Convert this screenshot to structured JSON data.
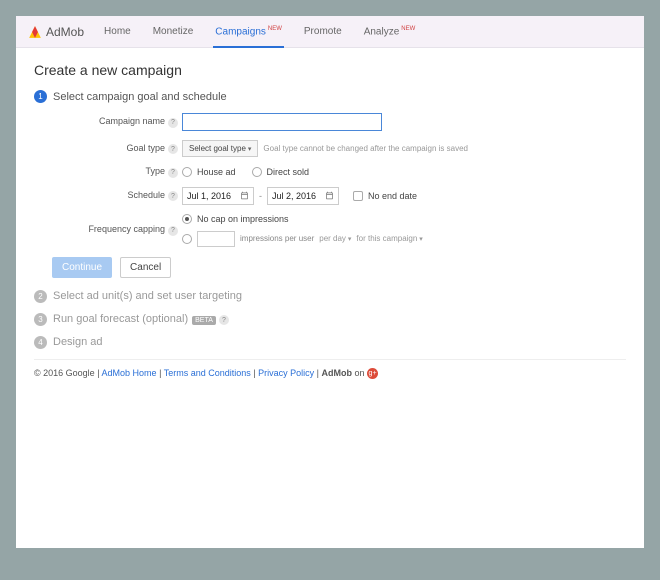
{
  "brand": "AdMob",
  "nav": {
    "home": "Home",
    "monetize": "Monetize",
    "campaigns": "Campaigns",
    "promote": "Promote",
    "analyze": "Analyze",
    "new_badge": "NEW"
  },
  "page_title": "Create a new campaign",
  "steps": {
    "s1": "Select campaign goal and schedule",
    "s2": "Select ad unit(s) and set user targeting",
    "s3": "Run goal forecast (optional)",
    "s3_beta": "BETA",
    "s4": "Design ad"
  },
  "form": {
    "name_label": "Campaign name",
    "goal_label": "Goal type",
    "goal_select": "Select goal type",
    "goal_hint": "Goal type cannot be changed after the campaign is saved",
    "type_label": "Type",
    "type_house": "House ad",
    "type_direct": "Direct sold",
    "schedule_label": "Schedule",
    "date_start": "Jul 1, 2016",
    "date_end": "Jul 2, 2016",
    "no_end": "No end date",
    "freq_label": "Frequency capping",
    "freq_nocap": "No cap on impressions",
    "freq_impr": "impressions per user",
    "freq_period": "per day",
    "freq_scope": "for this campaign"
  },
  "buttons": {
    "continue": "Continue",
    "cancel": "Cancel"
  },
  "footer": {
    "copyright": "© 2016 Google",
    "home": "AdMob Home",
    "terms": "Terms and Conditions",
    "privacy": "Privacy Policy",
    "brand": "AdMob",
    "on": "on"
  }
}
